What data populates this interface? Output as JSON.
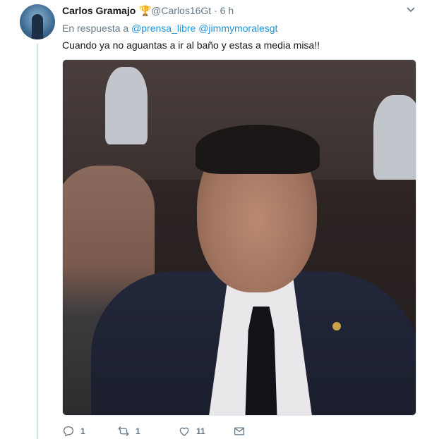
{
  "tweet": {
    "author_name": "Carlos Gramajo",
    "badge_icon": "trophy-icon",
    "handle": "@Carlos16Gt",
    "separator": "·",
    "time": "6 h",
    "reply_prefix": "En respuesta a",
    "reply_mentions": [
      "@prensa_libre",
      "@jimmymoralesgt"
    ],
    "text": "Cuando ya no aguantas a ir al baño y estas a media misa!!",
    "media_icon": "photo"
  },
  "actions": {
    "reply": {
      "icon": "reply-icon",
      "count": "1"
    },
    "retweet": {
      "icon": "retweet-icon",
      "count": "1"
    },
    "like": {
      "icon": "heart-icon",
      "count": "11"
    },
    "message": {
      "icon": "envelope-icon"
    }
  },
  "colors": {
    "link": "#1b95e0",
    "muted": "#657786",
    "text": "#14171a",
    "thread_line": "#cfe3f0"
  }
}
